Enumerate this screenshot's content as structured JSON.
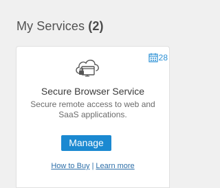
{
  "section": {
    "title": "My Services",
    "count": "(2)"
  },
  "service_card": {
    "icon": "secure-browser-cloud-icon",
    "trial_days": "28",
    "trial_icon": "calendar-icon",
    "name": "Secure Browser Service",
    "description": "Secure remote access to web and SaaS applications.",
    "manage_label": "Manage",
    "how_to_buy_label": "How to Buy",
    "separator": "|",
    "learn_more_label": "Learn more"
  },
  "colors": {
    "accent": "#1b89d1",
    "link": "#2c6ea8",
    "badge": "#2a8fd4",
    "background": "#f0f0f0"
  }
}
